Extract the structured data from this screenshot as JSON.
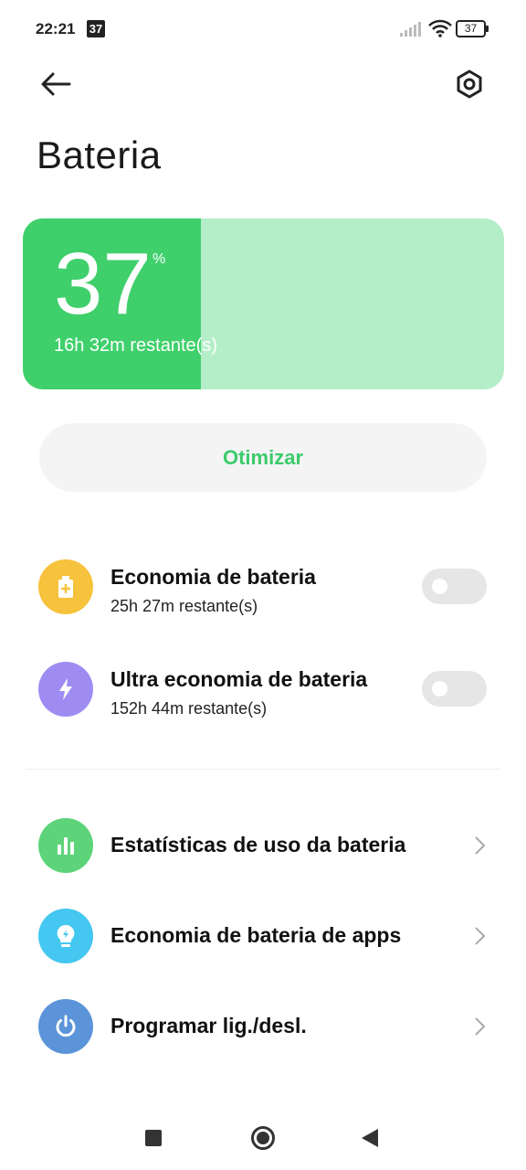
{
  "status_bar": {
    "time": "22:21",
    "calendar_badge": "37",
    "battery_text": "37"
  },
  "header": {
    "title": "Bateria"
  },
  "battery": {
    "level": "37",
    "percent_sign": "%",
    "level_fraction": 0.37,
    "remaining": "16h 32m restante(s)"
  },
  "optimize": {
    "label": "Otimizar"
  },
  "modes": [
    {
      "title": "Economia de bateria",
      "subtitle": "25h 27m restante(s)",
      "icon": "battery-plus-icon",
      "color": "#f7c23c",
      "enabled": false
    },
    {
      "title": "Ultra economia de bateria",
      "subtitle": "152h 44m restante(s)",
      "icon": "lightning-icon",
      "color": "#9f8cf2",
      "enabled": false
    }
  ],
  "menu": [
    {
      "title": "Estatísticas de uso da bateria",
      "icon": "bar-chart-icon",
      "color": "#5dd47a"
    },
    {
      "title": "Economia de bateria de apps",
      "icon": "lightbulb-icon",
      "color": "#44c7f0"
    },
    {
      "title": "Programar lig./desl.",
      "icon": "power-icon",
      "color": "#5b94d9"
    }
  ],
  "colors": {
    "accent_green": "#3fd06b",
    "card_bg": "#b4eec8",
    "optimize_text": "#3ccb6a"
  }
}
